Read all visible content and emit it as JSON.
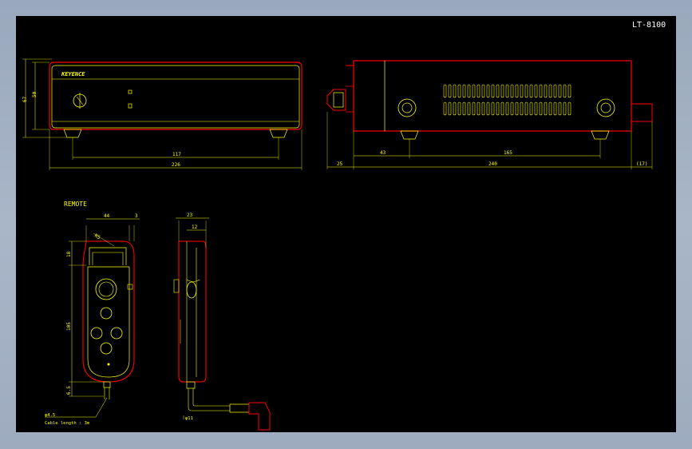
{
  "drawing": {
    "title_block": "LT-8100",
    "brand": "KEYENCE",
    "remote_label": "REMOTE",
    "cable_note": "Cable length : 3m",
    "colors": {
      "background": "#000000",
      "outline": "#ff0000",
      "body": "#ffff00",
      "text": "#ffff00",
      "title": "#ffffff"
    }
  },
  "dimensions": {
    "front": {
      "height_total": "67",
      "height_body": "50",
      "feet_span": "117",
      "width": "226"
    },
    "side": {
      "key_offset": "25",
      "foot_left": "43",
      "foot_span": "165",
      "depth": "240",
      "rear": "(17)"
    },
    "remote_front": {
      "width": "44",
      "edge": "3",
      "radius": "R5",
      "top": "18",
      "length": "105",
      "bottom": "6.5",
      "cable_dia": "φ4.5"
    },
    "remote_side": {
      "thickness": "23",
      "inner": "12",
      "cable_dia": "φ11"
    }
  }
}
